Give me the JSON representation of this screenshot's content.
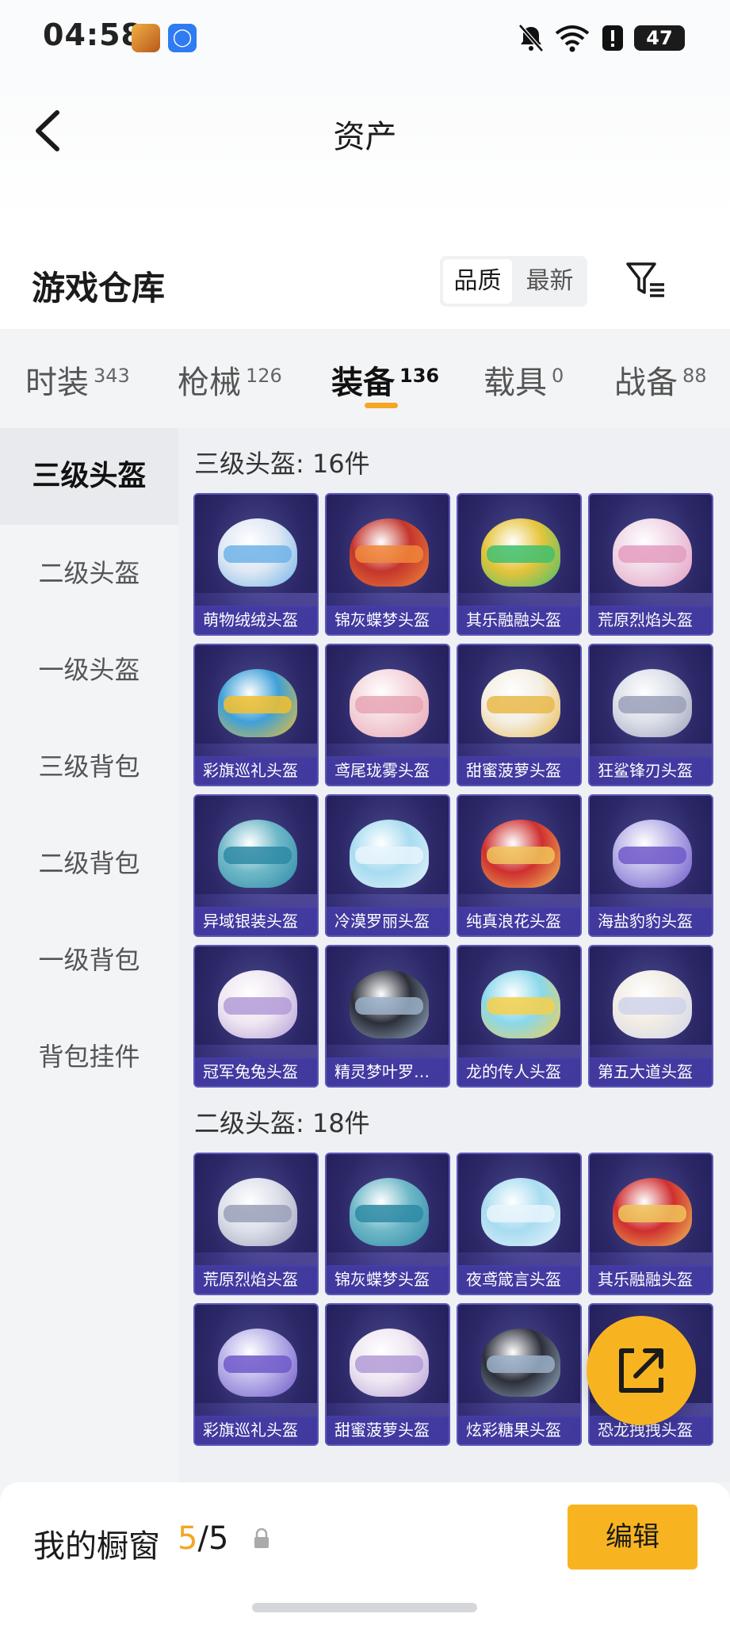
{
  "status_bar": {
    "time": "04:58",
    "battery": "47"
  },
  "header": {
    "title": "资产"
  },
  "warehouse": {
    "title": "游戏仓库",
    "sort_options": [
      "品质",
      "最新"
    ],
    "sort_active": "品质"
  },
  "tabs": [
    {
      "label": "时装",
      "count": "343"
    },
    {
      "label": "枪械",
      "count": "126"
    },
    {
      "label": "装备",
      "count": "136"
    },
    {
      "label": "载具",
      "count": "0"
    },
    {
      "label": "战备",
      "count": "88"
    }
  ],
  "active_tab": "装备",
  "sidebar": {
    "items": [
      "三级头盔",
      "二级头盔",
      "一级头盔",
      "三级背包",
      "二级背包",
      "一级背包",
      "背包挂件"
    ],
    "active": "三级头盔"
  },
  "sections": [
    {
      "title": "三级头盔: 16件",
      "items": [
        "萌物绒绒头盔",
        "锦灰蝶梦头盔",
        "其乐融融头盔",
        "荒原烈焰头盔",
        "彩旗巡礼头盔",
        "鸢尾珑雾头盔",
        "甜蜜菠萝头盔",
        "狂鲨锋刃头盔",
        "异域银装头盔",
        "冷漠罗丽头盔",
        "纯真浪花头盔",
        "海盐豹豹头盔",
        "冠军兔兔头盔",
        "精灵梦叶罗头盔",
        "龙的传人头盔",
        "第五大道头盔"
      ]
    },
    {
      "title": "二级头盔: 18件",
      "items": [
        "荒原烈焰头盔",
        "锦灰蝶梦头盔",
        "夜鸢箴言头盔",
        "其乐融融头盔",
        "彩旗巡礼头盔",
        "甜蜜菠萝头盔",
        "炫彩糖果头盔",
        "恐龙拽拽头盔"
      ]
    }
  ],
  "bottom_bar": {
    "label": "我的橱窗",
    "count_current": "5",
    "count_sep": "/",
    "count_total": "5",
    "edit_label": "编辑"
  },
  "colors": {
    "accent": "#f8b420",
    "card_bg": "#2c2868",
    "card_label": "#463eaa"
  }
}
